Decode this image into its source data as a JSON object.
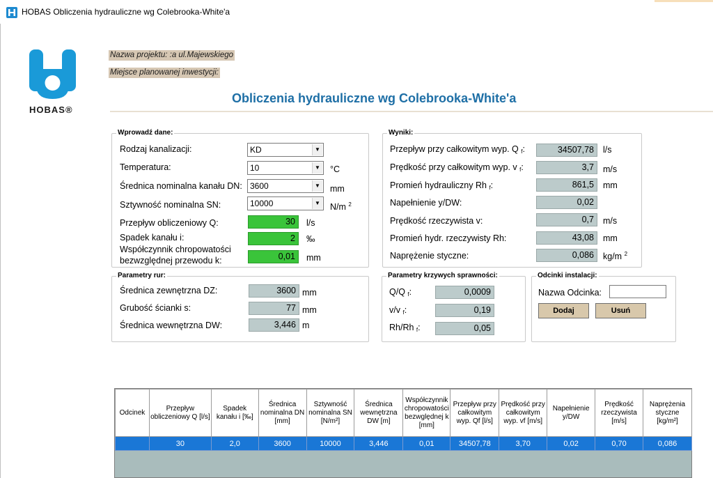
{
  "window": {
    "title": "HOBAS Obliczenia hydrauliczne wg Colebrooka-White'a"
  },
  "logo": {
    "text": "HOBAS®"
  },
  "project": {
    "name_label": "Nazwa Projektu:",
    "name_value": "Nazwa projektu: :a ul.Majewskiego",
    "location_label": "Miejsce planowanej inwestycji:",
    "location_value": "Miejsce planowanej inwestycji:"
  },
  "main_title": "Obliczenia hydrauliczne wg Colebrooka-White'a",
  "input": {
    "legend": "Wprowadź dane:",
    "sewer_type_label": "Rodzaj kanalizacji:",
    "sewer_type_value": "KD",
    "temperature_label": "Temperatura:",
    "temperature_value": "10",
    "temperature_unit": "°C",
    "dn_label": "Średnica nominalna kanału DN:",
    "dn_value": "3600",
    "dn_unit": "mm",
    "sn_label": "Sztywność nominalna SN:",
    "sn_value": "10000",
    "sn_unit": "N/m",
    "sn_unit_sup": "2",
    "flow_label": "Przepływ obliczeniowy Q:",
    "flow_value": "30",
    "flow_unit": "l/s",
    "slope_label": "Spadek kanału i:",
    "slope_value": "2",
    "slope_unit": "‰",
    "roughness_label_1": "Współczynnik chropowatości",
    "roughness_label_2": "bezwzględnej przewodu k:",
    "roughness_value": "0,01",
    "roughness_unit": "mm"
  },
  "results": {
    "legend": "Wyniki:",
    "qf_label": "Przepływ przy całkowitym wyp. Q",
    "qf_value": "34507,78",
    "qf_unit": "l/s",
    "vf_label": "Prędkość przy całkowitym wyp. v",
    "vf_value": "3,7",
    "vf_unit": "m/s",
    "rhf_label": "Promień hydrauliczny Rh",
    "rhf_value": "861,5",
    "rhf_unit": "mm",
    "fill_label": "Napełnienie y/DW:",
    "fill_value": "0,02",
    "v_label": "Prędkość rzeczywista v:",
    "v_value": "0,7",
    "v_unit": "m/s",
    "rh_label": "Promień hydr. rzeczywisty Rh:",
    "rh_value": "43,08",
    "rh_unit": "mm",
    "stress_label": "Naprężenie styczne:",
    "stress_value": "0,086",
    "stress_unit": "kg/m",
    "stress_unit_sup": "2",
    "sub_f": "f",
    "colon": ":"
  },
  "pipe": {
    "legend": "Parametry rur:",
    "dz_label": "Średnica zewnętrzna DZ:",
    "dz_value": "3600",
    "dz_unit": "mm",
    "wall_label": "Grubość ścianki s:",
    "wall_value": "77",
    "wall_unit": "mm",
    "dw_label": "Średnica wewnętrzna DW:",
    "dw_value": "3,446",
    "dw_unit": "m"
  },
  "curves": {
    "legend": "Parametry krzywych sprawności:",
    "qq_label": "Q/Q",
    "qq_value": "0,0009",
    "vv_label": "v/v",
    "vv_value": "0,19",
    "rr_label": "Rh/Rh",
    "rr_value": "0,05"
  },
  "segments": {
    "legend": "Odcinki instalacji:",
    "name_label": "Nazwa Odcinka:",
    "name_value": "",
    "add_button": "Dodaj",
    "remove_button": "Usuń"
  },
  "table": {
    "headers": [
      "Odcinek",
      "Przepływ obliczeniowy Q [l/s]",
      "Spadek kanału i [‰]",
      "Średnica nominalna DN [mm]",
      "Sztywność nominalna SN [N/m²]",
      "Średnica wewnętrzna DW [m]",
      "Współczynnik chropowatości bezwględnej k [mm]",
      "Przepływ przy całkowitym wyp. Qf [l/s]",
      "Prędkość przy całkowitym wyp. vf [m/s]",
      "Napełnienie y/DW",
      "Prędkość rzeczywista [m/s]",
      "Naprężenia styczne [kg/m²]"
    ],
    "rows": [
      [
        "",
        "30",
        "2,0",
        "3600",
        "10000",
        "3,446",
        "0,01",
        "34507,78",
        "3,70",
        "0,02",
        "0,70",
        "0,086"
      ]
    ]
  },
  "colors": {
    "accent_title": "#1e6fa6",
    "input_green": "#3ac43a",
    "output_grey": "#bccbcb",
    "selected_row": "#1a77d6",
    "button": "#d8c8ab",
    "project_bar": "#d6c7b3"
  }
}
